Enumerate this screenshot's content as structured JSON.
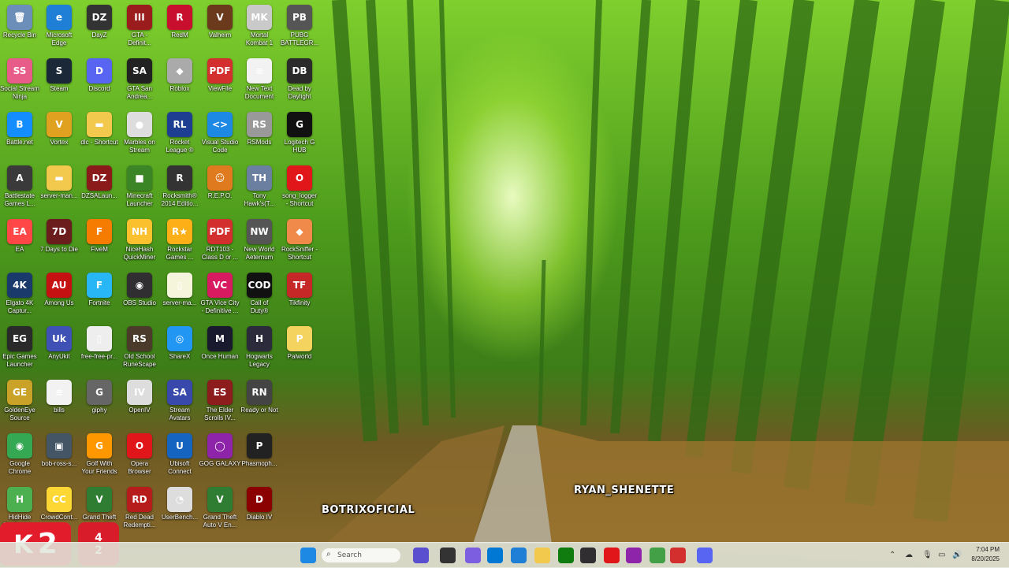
{
  "desktop": {
    "icons": [
      {
        "label": "Recycle Bin",
        "glyph": "🗑",
        "color": "#6b8fb8"
      },
      {
        "label": "Microsoft\nEdge",
        "glyph": "e",
        "color": "#1f7fd6"
      },
      {
        "label": "DayZ",
        "glyph": "DZ",
        "color": "#333333"
      },
      {
        "label": "GTA -\nDefinit...",
        "glyph": "III",
        "color": "#9b1c1c"
      },
      {
        "label": "RedM",
        "glyph": "R",
        "color": "#c8102e"
      },
      {
        "label": "Valheim",
        "glyph": "V",
        "color": "#6b3a1c"
      },
      {
        "label": "Mortal\nKombat 1",
        "glyph": "MK",
        "color": "#c9c9c9"
      },
      {
        "label": "PUBG\nBATTLEGR...",
        "glyph": "PB",
        "color": "#555555"
      },
      {
        "label": "Social Stream\nNinja",
        "glyph": "SS",
        "color": "#e85c8a"
      },
      {
        "label": "Steam",
        "glyph": "S",
        "color": "#1b2838"
      },
      {
        "label": "Discord",
        "glyph": "D",
        "color": "#5865f2"
      },
      {
        "label": "GTA San\nAndrea...",
        "glyph": "SA",
        "color": "#222222"
      },
      {
        "label": "Roblox",
        "glyph": "◆",
        "color": "#aaaaaa"
      },
      {
        "label": "ViewFile",
        "glyph": "PDF",
        "color": "#d32f2f"
      },
      {
        "label": "New Text\nDocument",
        "glyph": "≡",
        "color": "#f2f2f2"
      },
      {
        "label": "Dead by\nDaylight",
        "glyph": "DB",
        "color": "#2b2b2b"
      },
      {
        "label": "Battle.net",
        "glyph": "B",
        "color": "#148eff"
      },
      {
        "label": "Vortex",
        "glyph": "V",
        "color": "#e0a020"
      },
      {
        "label": "dlc - Shortcut",
        "glyph": "▬",
        "color": "#f2c94c"
      },
      {
        "label": "Marbles on\nStream",
        "glyph": "●",
        "color": "#dddddd"
      },
      {
        "label": "Rocket\nLeague ®",
        "glyph": "RL",
        "color": "#1e3f91"
      },
      {
        "label": "Visual Studio\nCode",
        "glyph": "<>",
        "color": "#1e88e5"
      },
      {
        "label": "RSMods",
        "glyph": "RS",
        "color": "#999999"
      },
      {
        "label": "Logitech G\nHUB",
        "glyph": "G",
        "color": "#111111"
      },
      {
        "label": "Battlestate\nGames L...",
        "glyph": "A",
        "color": "#3a3a3a"
      },
      {
        "label": "server-man...",
        "glyph": "▬",
        "color": "#f2c94c"
      },
      {
        "label": "DZSALaun...",
        "glyph": "DZ",
        "color": "#8b1a1a"
      },
      {
        "label": "Minecraft\nLauncher",
        "glyph": "■",
        "color": "#3c8527"
      },
      {
        "label": "Rocksmith®\n2014 Editio...",
        "glyph": "R",
        "color": "#333333"
      },
      {
        "label": "R.E.P.O.",
        "glyph": "☺",
        "color": "#e07a1f"
      },
      {
        "label": "Tony\nHawk's(T...",
        "glyph": "TH",
        "color": "#6b7fa0"
      },
      {
        "label": "song_logger\n- Shortcut",
        "glyph": "O",
        "color": "#e0161b"
      },
      {
        "label": "EA",
        "glyph": "EA",
        "color": "#ff4747"
      },
      {
        "label": "7 Days to Die",
        "glyph": "7D",
        "color": "#6b1c1c"
      },
      {
        "label": "FiveM",
        "glyph": "F",
        "color": "#f57c00"
      },
      {
        "label": "NiceHash\nQuickMiner",
        "glyph": "NH",
        "color": "#fbc02d"
      },
      {
        "label": "Rockstar\nGames ...",
        "glyph": "R★",
        "color": "#fcaf17"
      },
      {
        "label": "RDT103 -\nClass D or ...",
        "glyph": "PDF",
        "color": "#d32f2f"
      },
      {
        "label": "New World\nAeternum",
        "glyph": "NW",
        "color": "#555555"
      },
      {
        "label": "RockSniffer -\nShortcut",
        "glyph": "◆",
        "color": "#f08a4b"
      },
      {
        "label": "Elgato 4K\nCaptur...",
        "glyph": "4K",
        "color": "#1a3a6b"
      },
      {
        "label": "Among Us",
        "glyph": "AU",
        "color": "#c51111"
      },
      {
        "label": "Fortnite",
        "glyph": "F",
        "color": "#29b6f6"
      },
      {
        "label": "OBS Studio",
        "glyph": "◉",
        "color": "#302e31"
      },
      {
        "label": "server-ma...",
        "glyph": "▯",
        "color": "#f5f5dc"
      },
      {
        "label": "GTA Vice City\n- Definitive ...",
        "glyph": "VC",
        "color": "#d81b60"
      },
      {
        "label": "Call of\nDuty®",
        "glyph": "COD",
        "color": "#111111"
      },
      {
        "label": "Tikfinity",
        "glyph": "TF",
        "color": "#c62828"
      },
      {
        "label": "Epic Games\nLauncher",
        "glyph": "EG",
        "color": "#2a2a2a"
      },
      {
        "label": "AnyUkit",
        "glyph": "Uk",
        "color": "#3f51b5"
      },
      {
        "label": "free-free-pr...",
        "glyph": "▯",
        "color": "#eeeeee"
      },
      {
        "label": "Old School\nRuneScape",
        "glyph": "RS",
        "color": "#4a3b2a"
      },
      {
        "label": "ShareX",
        "glyph": "◎",
        "color": "#2196f3"
      },
      {
        "label": "Once Human",
        "glyph": "M",
        "color": "#1a1a2e"
      },
      {
        "label": "Hogwarts\nLegacy",
        "glyph": "H",
        "color": "#2b2b3b"
      },
      {
        "label": "Palworld",
        "glyph": "P",
        "color": "#f4d35e"
      },
      {
        "label": "GoldenEye\nSource",
        "glyph": "GE",
        "color": "#c9a227"
      },
      {
        "label": "bills",
        "glyph": "≡",
        "color": "#f2f2f2"
      },
      {
        "label": "giphy",
        "glyph": "G",
        "color": "#666666"
      },
      {
        "label": "OpenIV",
        "glyph": "IV",
        "color": "#dddddd"
      },
      {
        "label": "Stream\nAvatars",
        "glyph": "SA",
        "color": "#3949ab"
      },
      {
        "label": "The Elder\nScrolls IV...",
        "glyph": "ES",
        "color": "#8d1c1c"
      },
      {
        "label": "Ready or Not",
        "glyph": "RN",
        "color": "#444444"
      },
      {
        "label": "Google\nChrome",
        "glyph": "◉",
        "color": "#34a853"
      },
      {
        "label": "bob-ross-s...",
        "glyph": "▣",
        "color": "#445566"
      },
      {
        "label": "Golf With\nYour Friends",
        "glyph": "G",
        "color": "#ff9800"
      },
      {
        "label": "Opera\nBrowser",
        "glyph": "O",
        "color": "#e0161b"
      },
      {
        "label": "Ubisoft\nConnect",
        "glyph": "U",
        "color": "#1565c0"
      },
      {
        "label": "GOG GALAXY",
        "glyph": "◯",
        "color": "#8e24aa"
      },
      {
        "label": "Phasmoph...",
        "glyph": "P",
        "color": "#222222"
      },
      {
        "label": "HidHide\nConfigurat...",
        "glyph": "H",
        "color": "#4caf50"
      },
      {
        "label": "CrowdCont...",
        "glyph": "CC",
        "color": "#fdd835"
      },
      {
        "label": "Grand Theft\nAuto V",
        "glyph": "V",
        "color": "#2e7d32"
      },
      {
        "label": "Red Dead\nRedempti...",
        "glyph": "RD",
        "color": "#b71c1c"
      },
      {
        "label": "UserBench...",
        "glyph": "◔",
        "color": "#dddddd"
      },
      {
        "label": "Grand Theft\nAuto V En...",
        "glyph": "V",
        "color": "#2e7d32"
      },
      {
        "label": "Diablo IV",
        "glyph": "D",
        "color": "#8b0000"
      }
    ]
  },
  "overlay": {
    "name_left": "BOTRIXOFICIAL",
    "name_right": "RYAN_SHENETTE"
  },
  "badges": {
    "primary_number": "2",
    "secondary_top": "4",
    "secondary_bottom": "2"
  },
  "taskbar": {
    "search_placeholder": "Search",
    "icons": [
      {
        "name": "start-icon",
        "color": "#1e88e5"
      },
      {
        "name": "search-icon",
        "color": "#555555"
      },
      {
        "name": "copilot-icon",
        "color": "#5a4fcf"
      },
      {
        "name": "task-view-icon",
        "color": "#333333"
      },
      {
        "name": "copilot-app-icon",
        "color": "#7b5fe0"
      },
      {
        "name": "store-icon",
        "color": "#0078d4"
      },
      {
        "name": "edge-icon",
        "color": "#1f7fd6"
      },
      {
        "name": "file-explorer-icon",
        "color": "#f2c94c"
      },
      {
        "name": "xbox-icon",
        "color": "#107c10"
      },
      {
        "name": "obs-icon",
        "color": "#302e31"
      },
      {
        "name": "opera-icon",
        "color": "#e0161b"
      },
      {
        "name": "app-icon",
        "color": "#8e24aa"
      },
      {
        "name": "games-icon",
        "color": "#43a047"
      },
      {
        "name": "text-app-icon",
        "color": "#d32f2f"
      },
      {
        "name": "discord-icon",
        "color": "#5865f2"
      }
    ]
  },
  "clock": {
    "time": "7:04 PM",
    "date": "8/20/2025"
  }
}
